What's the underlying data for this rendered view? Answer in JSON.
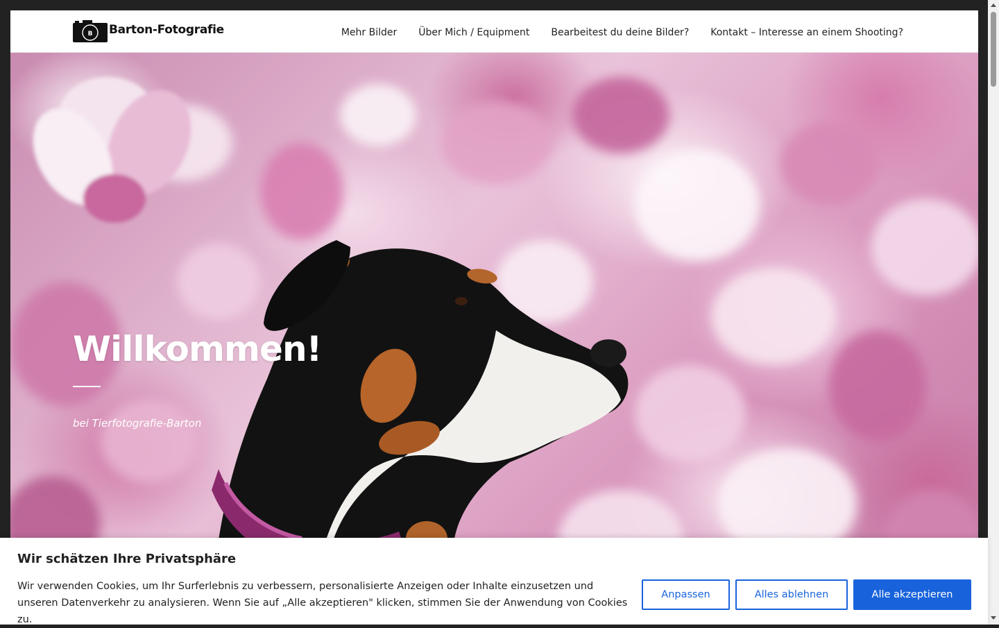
{
  "header": {
    "logo_letter": "B",
    "logo_text": "Barton-Fotografie",
    "nav": [
      {
        "label": "Mehr Bilder"
      },
      {
        "label": "Über Mich / Equipment"
      },
      {
        "label": "Bearbeitest du deine Bilder?"
      },
      {
        "label": "Kontakt – Interesse an einem Shooting?"
      }
    ]
  },
  "hero": {
    "title": "Willkommen!",
    "subtitle": "bei Tierfotografie-Barton"
  },
  "cookie": {
    "title": "Wir schätzen Ihre Privatsphäre",
    "text": "Wir verwenden Cookies, um Ihr Surferlebnis zu verbessern, personalisierte Anzeigen oder Inhalte einzusetzen und unseren Datenverkehr zu analysieren. Wenn Sie auf „Alle akzeptieren\" klicken, stimmen Sie der Anwendung von Cookies zu.",
    "buttons": {
      "customize": "Anpassen",
      "reject": "Alles ablehnen",
      "accept": "Alle akzeptieren"
    }
  },
  "colors": {
    "accent": "#1863dc",
    "frame": "#222222",
    "header_bg": "#ffffff"
  },
  "icons": {
    "logo": "camera-icon"
  }
}
